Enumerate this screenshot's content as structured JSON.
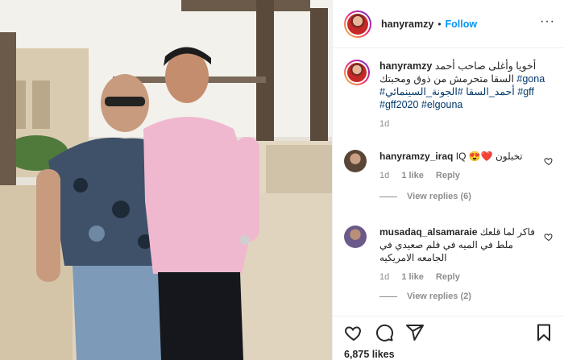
{
  "post": {
    "username": "hanyramzy",
    "separator": "•",
    "follow_label": "Follow",
    "more_label": "···"
  },
  "caption": {
    "username": "hanyramzy",
    "text": "أخويا وأغلى صاحب أحمد السقا متحرمش من ذوق ومحبتك",
    "hashtags": [
      "#gona",
      "#أحمد_السقا",
      "#الجونة_السينمائي",
      "#gff",
      "#gff2020",
      "#elgouna"
    ],
    "time": "1d"
  },
  "comments": [
    {
      "username": "hanyramzy_iraq",
      "text": "تخبلون ❤️😍 IQ",
      "time": "1d",
      "likes": "1 like",
      "reply_label": "Reply",
      "view_replies": "View replies (6)"
    },
    {
      "username": "musadaq_alsamaraie",
      "text": "فاكر لما قلعك ملط في الميه في فلم صعيدي في الجامعه الامريكيه",
      "time": "1d",
      "likes": "1 like",
      "reply_label": "Reply",
      "view_replies": "View replies (2)"
    }
  ],
  "footer": {
    "likes": "6,875 likes"
  },
  "icons": {
    "like": "heart-icon",
    "comment": "comment-icon",
    "share": "share-icon",
    "save": "bookmark-icon",
    "more": "more-icon"
  },
  "colors": {
    "follow": "#0095f6",
    "hashtag": "#00376b",
    "meta": "#8e8e8e",
    "border": "#efefef"
  }
}
